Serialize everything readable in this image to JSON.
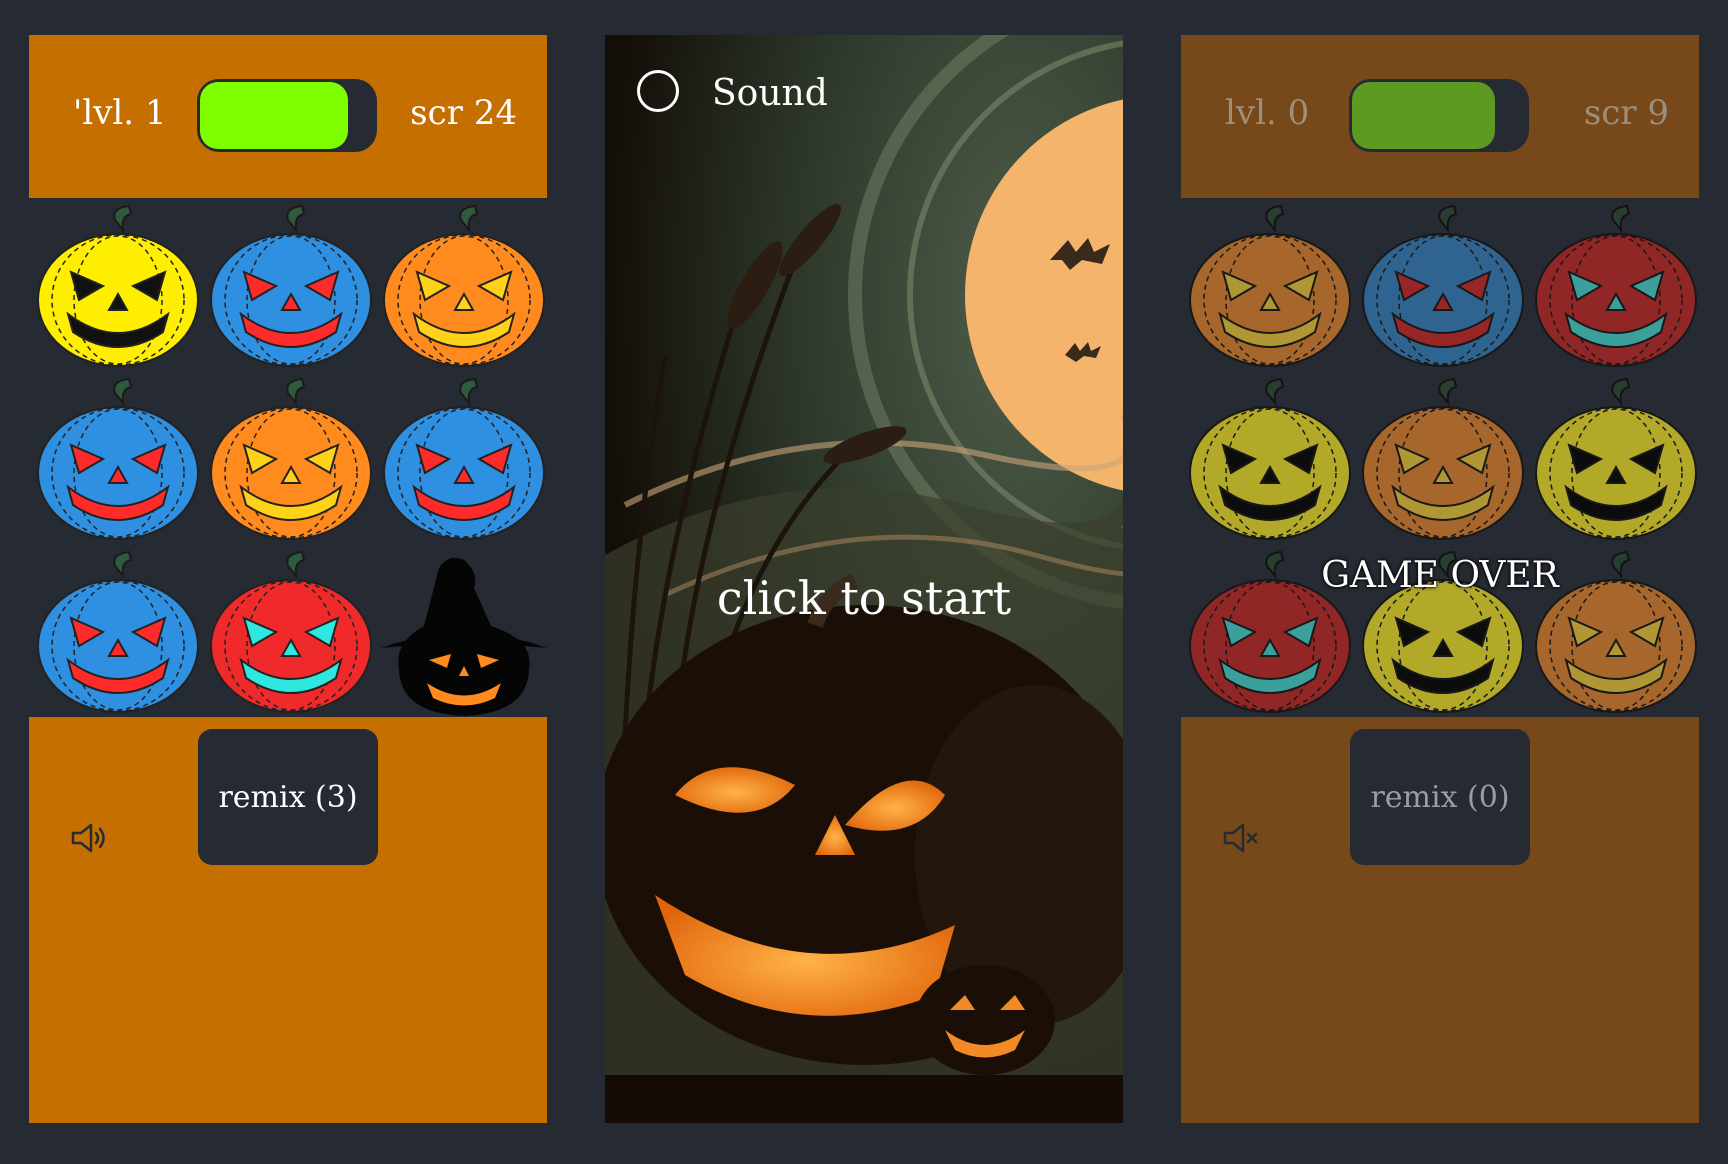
{
  "colors": {
    "page_bg": "#262a33",
    "panel_active": "#c56f00",
    "panel_inactive": "#76481a",
    "energy_active": "#7ffe00",
    "energy_inactive": "#5c9a22"
  },
  "left_game": {
    "level_label": "'lvl. 1",
    "score_label": "scr 24",
    "energy_level": 0.85,
    "sound_icon": "speaker-on-icon",
    "remix_label": "remix (3)",
    "board": [
      [
        "yellow",
        "blue",
        "orange"
      ],
      [
        "blue",
        "orange",
        "blue"
      ],
      [
        "blue",
        "red",
        "witch"
      ]
    ]
  },
  "start_screen": {
    "sound_label": "Sound",
    "start_label": "click to start"
  },
  "right_game": {
    "level_label": "lvl. 0",
    "score_label": "scr 9",
    "energy_level": 0.82,
    "sound_icon": "speaker-muted-icon",
    "remix_label": "remix (0)",
    "status_label": "GAME OVER",
    "board": [
      [
        "orange",
        "blue",
        "red"
      ],
      [
        "yellow",
        "orange",
        "yellow"
      ],
      [
        "red",
        "yellow",
        "orange"
      ]
    ]
  },
  "pumpkin_palette": {
    "yellow": {
      "body": "#ffee00",
      "face": "#111111"
    },
    "blue": {
      "body": "#2f8fe0",
      "face": "#ff2a2a"
    },
    "orange": {
      "body": "#ff8a1e",
      "face": "#ffd21a"
    },
    "red": {
      "body": "#f02a2a",
      "face": "#2ee8e0"
    }
  }
}
